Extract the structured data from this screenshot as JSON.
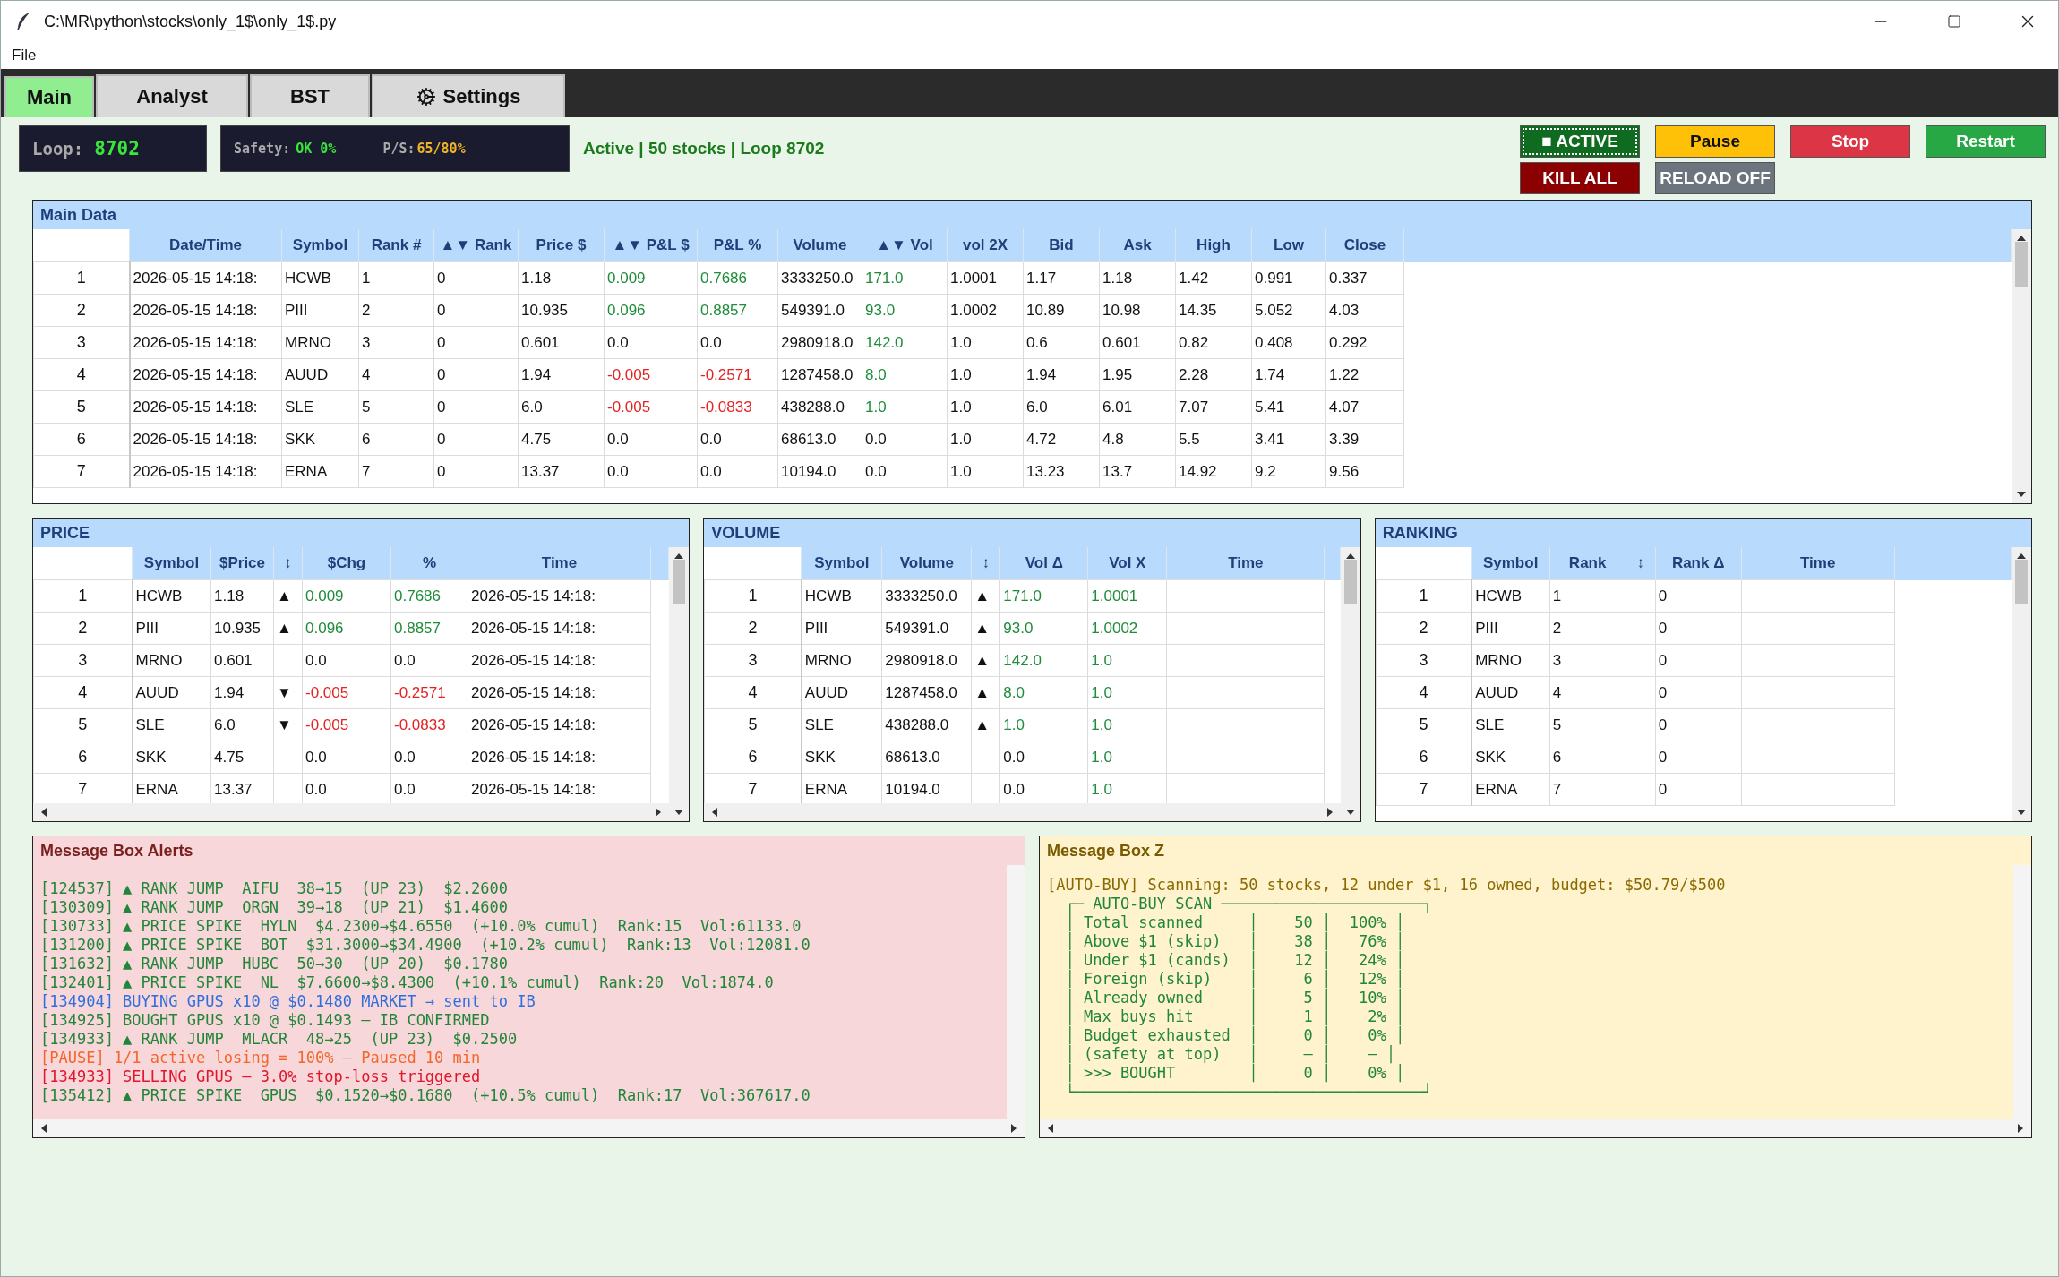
{
  "window": {
    "title": "C:\\MR\\python\\stocks\\only_1$\\only_1$.py"
  },
  "menu": [
    "File"
  ],
  "tabs": [
    {
      "label": "Main",
      "selected": true
    },
    {
      "label": "Analyst",
      "selected": false
    },
    {
      "label": "BST",
      "selected": false
    },
    {
      "label": "Settings",
      "selected": false
    }
  ],
  "loop": {
    "label": "Loop:",
    "value": "8702"
  },
  "safety": {
    "label": "Safety:",
    "value": "OK 0%",
    "ps_label": "P/S:",
    "ps_value": "65/80%"
  },
  "status_text": "Active | 50 stocks | Loop 8702",
  "buttons": [
    {
      "label": "■ ACTIVE",
      "color": "#0f6b1f",
      "focused": true
    },
    {
      "label": "Pause",
      "color": "#ffc107",
      "focused": false
    },
    {
      "label": "Stop",
      "color": "#dc3545",
      "focused": false
    },
    {
      "label": "Restart",
      "color": "#28a745",
      "focused": false
    },
    {
      "label": "KILL ALL",
      "color": "#8b0000",
      "focused": false
    },
    {
      "label": "RELOAD OFF",
      "color": "#6c757d",
      "focused": false
    }
  ],
  "main_table": {
    "title": "Main Data",
    "columns": [
      "",
      "Date/Time",
      "Symbol",
      "Rank #",
      "▲▼ Rank",
      "Price $",
      "▲▼ P&L $",
      "P&L %",
      "Volume",
      "▲▼ Vol",
      "vol 2X",
      "Bid",
      "Ask",
      "High",
      "Low",
      "Close"
    ],
    "rows": [
      {
        "cells": [
          "1",
          "2026-05-15 14:18:",
          "HCWB",
          "1",
          "0",
          "1.18",
          {
            "text": "0.009",
            "color": "#1e8c3a"
          },
          {
            "text": "0.7686",
            "color": "#1e8c3a"
          },
          "3333250.0",
          {
            "text": "171.0",
            "color": "#1e8c3a"
          },
          "1.0001",
          "1.17",
          "1.18",
          "1.42",
          "0.991",
          "0.337"
        ]
      },
      {
        "cells": [
          "2",
          "2026-05-15 14:18:",
          "PIII",
          "2",
          "0",
          "10.935",
          {
            "text": "0.096",
            "color": "#1e8c3a"
          },
          {
            "text": "0.8857",
            "color": "#1e8c3a"
          },
          "549391.0",
          {
            "text": "93.0",
            "color": "#1e8c3a"
          },
          "1.0002",
          "10.89",
          "10.98",
          "14.35",
          "5.052",
          "4.03"
        ]
      },
      {
        "cells": [
          "3",
          "2026-05-15 14:18:",
          "MRNO",
          "3",
          "0",
          "0.601",
          "0.0",
          "0.0",
          "2980918.0",
          {
            "text": "142.0",
            "color": "#1e8c3a"
          },
          "1.0",
          "0.6",
          "0.601",
          "0.82",
          "0.408",
          "0.292"
        ]
      },
      {
        "cells": [
          "4",
          "2026-05-15 14:18:",
          "AUUD",
          "4",
          "0",
          "1.94",
          {
            "text": "-0.005",
            "color": "#e32222"
          },
          {
            "text": "-0.2571",
            "color": "#e32222"
          },
          "1287458.0",
          {
            "text": "8.0",
            "color": "#1e8c3a"
          },
          "1.0",
          "1.94",
          "1.95",
          "2.28",
          "1.74",
          "1.22"
        ]
      },
      {
        "cells": [
          "5",
          "2026-05-15 14:18:",
          "SLE",
          "5",
          "0",
          "6.0",
          {
            "text": "-0.005",
            "color": "#e32222"
          },
          {
            "text": "-0.0833",
            "color": "#e32222"
          },
          "438288.0",
          {
            "text": "1.0",
            "color": "#1e8c3a"
          },
          "1.0",
          "6.0",
          "6.01",
          "7.07",
          "5.41",
          "4.07"
        ]
      },
      {
        "cells": [
          "6",
          "2026-05-15 14:18:",
          "SKK",
          "6",
          "0",
          "4.75",
          "0.0",
          "0.0",
          "68613.0",
          "0.0",
          "1.0",
          "4.72",
          "4.8",
          "5.5",
          "3.41",
          "3.39"
        ]
      },
      {
        "cells": [
          "7",
          "2026-05-15 14:18:",
          "ERNA",
          "7",
          "0",
          "13.37",
          "0.0",
          "0.0",
          "10194.0",
          "0.0",
          "1.0",
          "13.23",
          "13.7",
          "14.92",
          "9.2",
          "9.56"
        ]
      }
    ]
  },
  "panels": [
    {
      "title": "PRICE",
      "columns": [
        "",
        "Symbol",
        "$Price",
        "↕",
        "$Chg",
        "%",
        "Time"
      ],
      "rows": [
        {
          "cells": [
            "1",
            "HCWB",
            "1.18",
            "▲",
            {
              "text": "0.009",
              "color": "#1e8c3a"
            },
            {
              "text": "0.7686",
              "color": "#1e8c3a"
            },
            "2026-05-15 14:18:"
          ]
        },
        {
          "cells": [
            "2",
            "PIII",
            "10.935",
            "▲",
            {
              "text": "0.096",
              "color": "#1e8c3a"
            },
            {
              "text": "0.8857",
              "color": "#1e8c3a"
            },
            "2026-05-15 14:18:"
          ]
        },
        {
          "cells": [
            "3",
            "MRNO",
            "0.601",
            null,
            "0.0",
            "0.0",
            "2026-05-15 14:18:"
          ]
        },
        {
          "cells": [
            "4",
            "AUUD",
            "1.94",
            "▼",
            {
              "text": "-0.005",
              "color": "#e32222"
            },
            {
              "text": "-0.2571",
              "color": "#e32222"
            },
            "2026-05-15 14:18:"
          ]
        },
        {
          "cells": [
            "5",
            "SLE",
            "6.0",
            "▼",
            {
              "text": "-0.005",
              "color": "#e32222"
            },
            {
              "text": "-0.0833",
              "color": "#e32222"
            },
            "2026-05-15 14:18:"
          ]
        },
        {
          "cells": [
            "6",
            "SKK",
            "4.75",
            null,
            "0.0",
            "0.0",
            "2026-05-15 14:18:"
          ]
        },
        {
          "cells": [
            "7",
            "ERNA",
            "13.37",
            null,
            "0.0",
            "0.0",
            "2026-05-15 14:18:"
          ]
        }
      ]
    },
    {
      "title": "VOLUME",
      "columns": [
        "",
        "Symbol",
        "Volume",
        "↕",
        "Vol Δ",
        "Vol X",
        "Time"
      ],
      "rows": [
        {
          "cells": [
            "1",
            "HCWB",
            "3333250.0",
            "▲",
            {
              "text": "171.0",
              "color": "#1e8c3a"
            },
            {
              "text": "1.0001",
              "color": "#1e8c3a"
            },
            null
          ]
        },
        {
          "cells": [
            "2",
            "PIII",
            "549391.0",
            "▲",
            {
              "text": "93.0",
              "color": "#1e8c3a"
            },
            {
              "text": "1.0002",
              "color": "#1e8c3a"
            },
            null
          ]
        },
        {
          "cells": [
            "3",
            "MRNO",
            "2980918.0",
            "▲",
            {
              "text": "142.0",
              "color": "#1e8c3a"
            },
            {
              "text": "1.0",
              "color": "#1e8c3a"
            },
            null
          ]
        },
        {
          "cells": [
            "4",
            "AUUD",
            "1287458.0",
            "▲",
            {
              "text": "8.0",
              "color": "#1e8c3a"
            },
            {
              "text": "1.0",
              "color": "#1e8c3a"
            },
            null
          ]
        },
        {
          "cells": [
            "5",
            "SLE",
            "438288.0",
            "▲",
            {
              "text": "1.0",
              "color": "#1e8c3a"
            },
            {
              "text": "1.0",
              "color": "#1e8c3a"
            },
            null
          ]
        },
        {
          "cells": [
            "6",
            "SKK",
            "68613.0",
            null,
            "0.0",
            {
              "text": "1.0",
              "color": "#1e8c3a"
            },
            null
          ]
        },
        {
          "cells": [
            "7",
            "ERNA",
            "10194.0",
            null,
            "0.0",
            {
              "text": "1.0",
              "color": "#1e8c3a"
            },
            null
          ]
        }
      ]
    },
    {
      "title": "RANKING",
      "columns": [
        "",
        "Symbol",
        "Rank",
        "↕",
        "Rank Δ",
        "Time"
      ],
      "rows": [
        {
          "cells": [
            "1",
            "HCWB",
            "1",
            null,
            "0",
            null
          ]
        },
        {
          "cells": [
            "2",
            "PIII",
            "2",
            null,
            "0",
            null
          ]
        },
        {
          "cells": [
            "3",
            "MRNO",
            "3",
            null,
            "0",
            null
          ]
        },
        {
          "cells": [
            "4",
            "AUUD",
            "4",
            null,
            "0",
            null
          ]
        },
        {
          "cells": [
            "5",
            "SLE",
            "5",
            null,
            "0",
            null
          ]
        },
        {
          "cells": [
            "6",
            "SKK",
            "6",
            null,
            "0",
            null
          ]
        },
        {
          "cells": [
            "7",
            "ERNA",
            "7",
            null,
            "0",
            null
          ]
        }
      ]
    }
  ],
  "message_boxes": [
    {
      "title": "Message Box Alerts",
      "kind": "alerts",
      "lines": [
        {
          "text": "[124537] ▲ RANK JUMP  AIFU  38→15  (UP 23)  $2.2600",
          "color": "#22863a"
        },
        {
          "text": "[130309] ▲ RANK JUMP  ORGN  39→18  (UP 21)  $1.4600",
          "color": "#22863a"
        },
        {
          "text": "[130733] ▲ PRICE SPIKE  HYLN  $4.2300→$4.6550  (+10.0% cumul)  Rank:15  Vol:61133.0",
          "color": "#22863a"
        },
        {
          "text": "[131200] ▲ PRICE SPIKE  BOT  $31.3000→$34.4900  (+10.2% cumul)  Rank:13  Vol:12081.0",
          "color": "#22863a"
        },
        {
          "text": "[131632] ▲ RANK JUMP  HUBC  50→30  (UP 20)  $0.1780",
          "color": "#22863a"
        },
        {
          "text": "[132401] ▲ PRICE SPIKE  NL  $7.6600→$8.4300  (+10.1% cumul)  Rank:20  Vol:1874.0",
          "color": "#22863a"
        },
        {
          "text": "[134904] BUYING GPUS x10 @ $0.1480 MARKET → sent to IB",
          "color": "#2f6fdc"
        },
        {
          "text": "[134925] BOUGHT GPUS x10 @ $0.1493 — IB CONFIRMED",
          "color": "#22863a"
        },
        {
          "text": "[134933] ▲ RANK JUMP  MLACR  48→25  (UP 23)  $0.2500",
          "color": "#22863a"
        },
        {
          "text": "[PAUSE] 1/1 active losing = 100% — Paused 10 min",
          "color": "#f2662a"
        },
        {
          "text": "[134933] SELLING GPUS — 3.0% stop-loss triggered",
          "color": "#e0162b"
        },
        {
          "text": "[135412] ▲ PRICE SPIKE  GPUS  $0.1520→$0.1680  (+10.5% cumul)  Rank:17  Vol:367617.0",
          "color": "#22863a"
        }
      ]
    },
    {
      "title": "Message Box Z",
      "kind": "log",
      "lines": [
        {
          "text": "[AUTO-BUY] Scanning: 50 stocks, 12 under $1, 16 owned, budget: $50.79/$500",
          "color": "#8a6a00"
        },
        {
          "text": "  ┌─ AUTO-BUY SCAN ──────────────────────┐",
          "color": "#22863a"
        },
        {
          "text": "  │ Total scanned     │    50 │  100% │",
          "color": "#22863a"
        },
        {
          "text": "  │ Above $1 (skip)   │    38 │   76% │",
          "color": "#22863a"
        },
        {
          "text": "  │ Under $1 (cands)  │    12 │   24% │",
          "color": "#22863a"
        },
        {
          "text": "  │ Foreign (skip)    │     6 │   12% │",
          "color": "#22863a"
        },
        {
          "text": "  │ Already owned     │     5 │   10% │",
          "color": "#22863a"
        },
        {
          "text": "  │ Max buys hit      │     1 │    2% │",
          "color": "#22863a"
        },
        {
          "text": "  │ Budget exhausted  │     0 │    0% │",
          "color": "#22863a"
        },
        {
          "text": "  │ (safety at top)   │     – │    – │",
          "color": "#22863a"
        },
        {
          "text": "  │ >>> BOUGHT        │     0 │    0% │",
          "color": "#22863a"
        },
        {
          "text": "  └──────────────────────────────────────┘",
          "color": "#22863a"
        }
      ]
    }
  ]
}
